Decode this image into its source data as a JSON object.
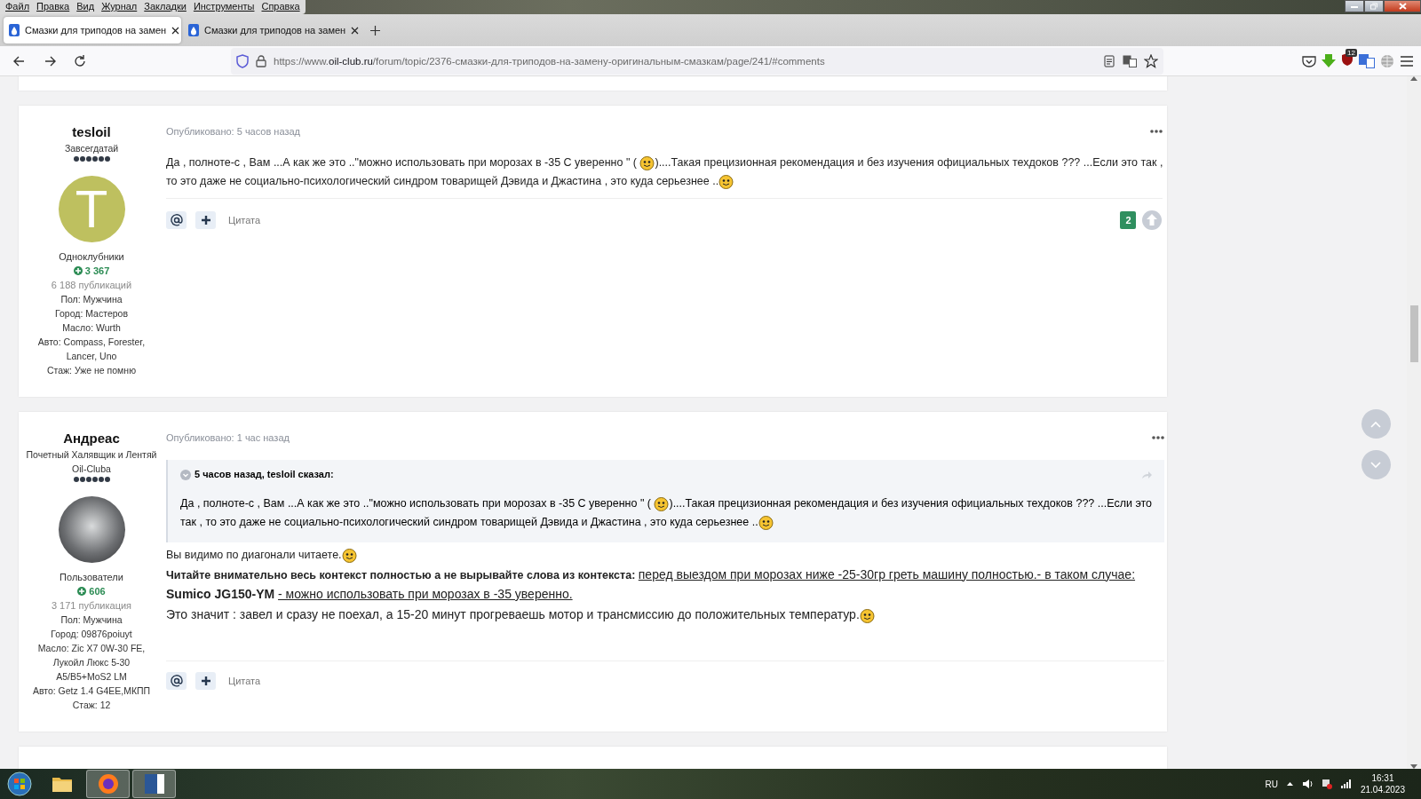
{
  "menu": [
    "Файл",
    "Правка",
    "Вид",
    "Журнал",
    "Закладки",
    "Инструменты",
    "Справка"
  ],
  "tabs": [
    {
      "title": "Смазки для триподов на замен",
      "selected": true
    },
    {
      "title": "Смазки для триподов на замен",
      "selected": false
    }
  ],
  "address": {
    "prefix": "https://www.",
    "domain": "oil-club.ru",
    "path": "/forum/topic/2376-смазки-для-триподов-на-замену-оригинальным-смазкам/page/241/#comments"
  },
  "extension_badge": "12",
  "posts": [
    {
      "author": "tesloil",
      "rank": "Завсегдатай",
      "stars": 6,
      "avatar": {
        "kind": "letter",
        "letter": "T"
      },
      "group": "Одноклубники",
      "reputation": "3 367",
      "count": "6 188 публикаций",
      "fields": [
        "Пол: Мужчина",
        "Город: Мастеров",
        "Масло: Wurth",
        "Авто: Compass, Forester, Lancer, Uno",
        "Стаж: Уже не помню"
      ],
      "published": "Опубликовано: 5 часов назад",
      "body": [
        [
          {
            "kind": "text",
            "text": "Да , полноте-с , Вам ...А как же это ..\"можно использовать при морозах в -35 С уверенно \" ( "
          },
          {
            "kind": "smiley"
          },
          {
            "kind": "text",
            "text": ")....Такая прецизионная рекомендация и без изучения официальных техдоков ??? ...Если это так ,"
          }
        ],
        [
          {
            "kind": "text",
            "text": "то это даже не социально-психологический синдром товарищей Дэвида и Джастина , это куда серьезнее .."
          },
          {
            "kind": "smiley"
          }
        ]
      ],
      "quote_button": "Цитата",
      "reactions": "2"
    },
    {
      "author": "Андреас",
      "rank": "Почетный Халявщик и Лентяй Oil-Cluba",
      "stars": 6,
      "avatar": {
        "kind": "photo"
      },
      "group": "Пользователи",
      "reputation": "606",
      "count": "3 171 публикация",
      "fields": [
        "Пол: Мужчина",
        "Город: 09876poiuyt",
        "Масло: Zic X7 0W-30 FE, Лукойл Люкс 5-30 A5/B5+MoS2 LM",
        "Авто: Getz 1.4 G4EE,МКПП",
        "Стаж: 12"
      ],
      "published": "Опубликовано: 1 час назад",
      "quote": {
        "header": "5 часов назад, tesloil сказал:",
        "body": [
          [
            {
              "kind": "text",
              "text": "Да , полноте-с , Вам ...А как же это ..\"можно использовать при морозах в -35 С уверенно \" ( "
            },
            {
              "kind": "smiley"
            },
            {
              "kind": "text",
              "text": ")....Такая прецизионная рекомендация и без изучения официальных техдоков ??? ...Если это"
            }
          ],
          [
            {
              "kind": "text",
              "text": "так , то это даже не социально-психологический синдром товарищей Дэвида и Джастина , это куда серьезнее .."
            },
            {
              "kind": "smiley"
            }
          ]
        ]
      },
      "body": [
        [
          {
            "kind": "text",
            "text": "Вы видимо по диагонали читаете."
          },
          {
            "kind": "smiley"
          }
        ],
        [
          {
            "kind": "bold",
            "text": "Читайте внимательно  весь контекст полностью а не вырывайте слова из контекста: "
          },
          {
            "kind": "link",
            "text": "перед выездом при морозах ниже -25-30гр греть машину полностью.- в таком случае:"
          }
        ],
        [
          {
            "kind": "strong",
            "text": "Sumico JG150-YM "
          },
          {
            "kind": "link",
            "text": " - можно использовать при морозах в -35 уверенно."
          }
        ],
        [
          {
            "kind": "large",
            "text": "Это значит : завел и сразу не поехал, а 15-20 минут прогреваешь мотор и трансмиссию до положительных температур."
          },
          {
            "kind": "smiley"
          }
        ]
      ],
      "quote_button": "Цитата"
    }
  ],
  "taskbar": {
    "apps": [
      {
        "kind": "folder",
        "selected": false
      },
      {
        "kind": "browser",
        "selected": true
      },
      {
        "kind": "word",
        "selected": true
      }
    ],
    "language": "RU",
    "time": "16:31",
    "date": "21.04.2023"
  }
}
